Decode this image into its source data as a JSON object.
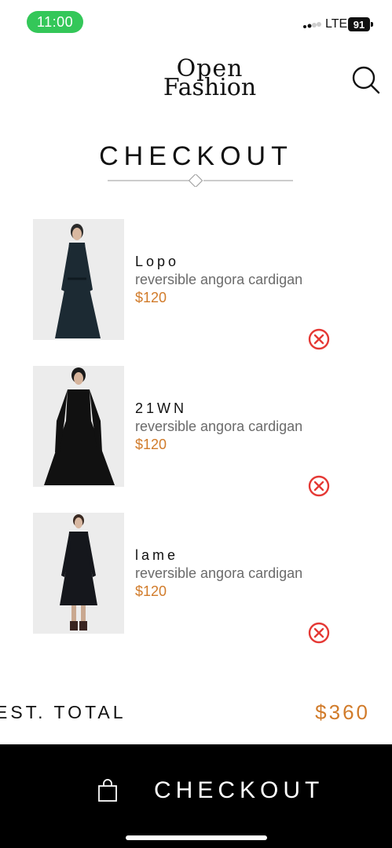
{
  "status_bar": {
    "time": "11:00",
    "network": "LTE",
    "battery": "91"
  },
  "header": {
    "logo_line1": "Open",
    "logo_line2": "Fashion"
  },
  "page_title": "CHECKOUT",
  "items": [
    {
      "brand": "Lopo",
      "description": "reversible angora cardigan",
      "price": "$120"
    },
    {
      "brand": "21WN",
      "description": "reversible angora cardigan",
      "price": "$120"
    },
    {
      "brand": "lame",
      "description": "reversible angora cardigan",
      "price": "$120"
    }
  ],
  "total": {
    "label": "EST. TOTAL",
    "value": "$360"
  },
  "footer": {
    "checkout_label": "CHECKOUT"
  },
  "colors": {
    "accent": "#d17b2a",
    "remove": "#e53935",
    "status_green": "#34c759"
  }
}
